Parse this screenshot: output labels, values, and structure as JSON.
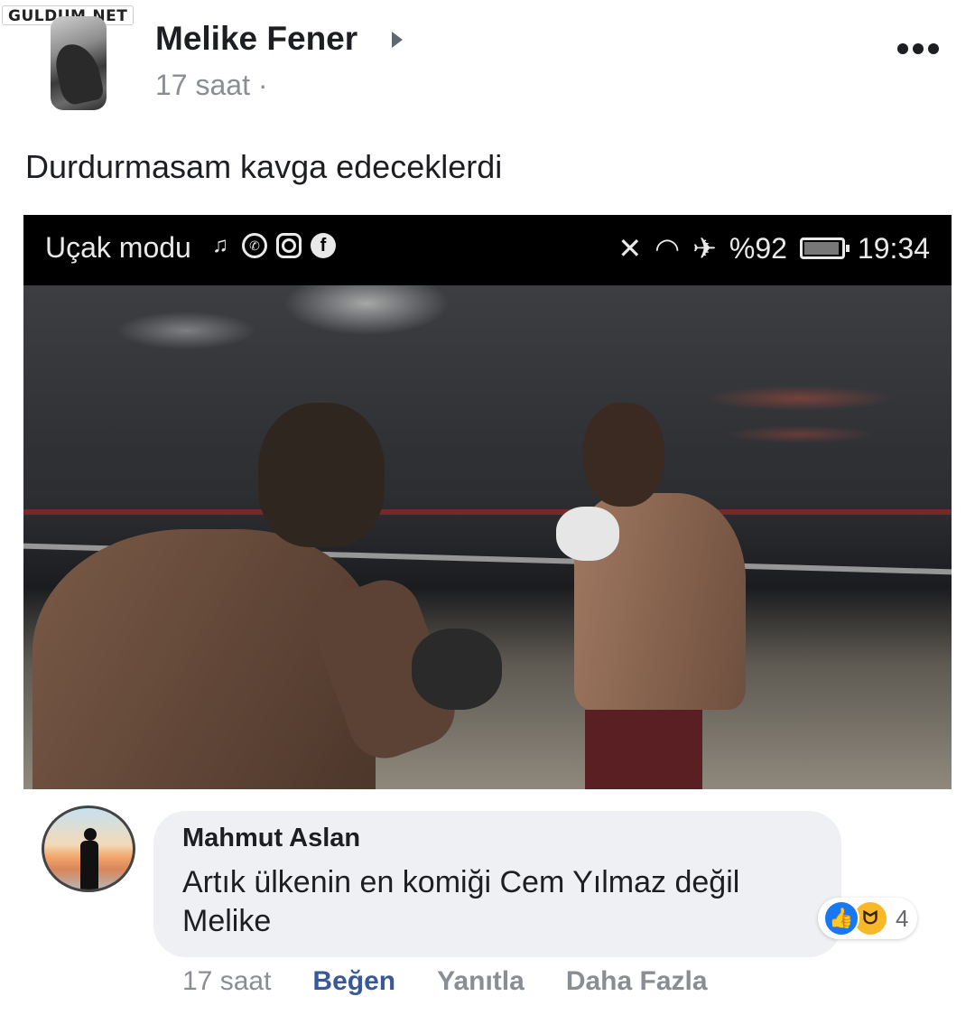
{
  "watermark": "GULDUM.NET",
  "post": {
    "author": "Melike Fener",
    "time": "17 saat ·",
    "text": "Durdurmasam kavga edeceklerdi"
  },
  "statusbar": {
    "carrier": "Uçak modu",
    "left_icons": [
      "music-note-icon",
      "whatsapp-icon",
      "instagram-icon",
      "facebook-icon"
    ],
    "right_icons": [
      "mute-icon",
      "wifi-icon",
      "airplane-icon",
      "battery-icon"
    ],
    "battery": "%92",
    "clock": "19:34"
  },
  "comment": {
    "author": "Mahmut Aslan",
    "text": "Artık ülkenin en komiği Cem Yılmaz değil Melike",
    "reaction_count": "4",
    "reactions": [
      "like-icon",
      "haha-icon"
    ],
    "time": "17 saat",
    "actions": {
      "like": "Beğen",
      "reply": "Yanıtla",
      "more": "Daha Fazla"
    }
  },
  "colors": {
    "link_blue": "#385898",
    "like_blue": "#1877f2",
    "bubble_gray": "#eef0f3",
    "muted_text": "#8a8d91"
  }
}
